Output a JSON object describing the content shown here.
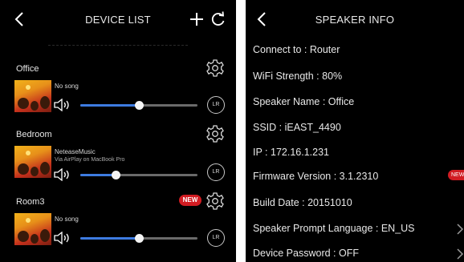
{
  "device_list": {
    "title": "DEVICE LIST",
    "rooms": [
      {
        "name": "Office",
        "song": "No song",
        "subtitle": "",
        "volume": 0.5,
        "lr_label": "LR",
        "new_badge": ""
      },
      {
        "name": "Bedroom",
        "song": "NeteaseMusic",
        "subtitle": "Via AirPlay on MacBook Pro",
        "volume": 0.3,
        "lr_label": "LR",
        "new_badge": ""
      },
      {
        "name": "Room3",
        "song": "No song",
        "subtitle": "",
        "volume": 0.5,
        "lr_label": "LR",
        "new_badge": "NEW"
      }
    ]
  },
  "speaker_info": {
    "title": "SPEAKER INFO",
    "rows": [
      "Connect to : Router",
      "WiFi Strength : 80%",
      "Speaker Name : Office",
      "SSID : iEAST_4490",
      "IP : 172.16.1.231",
      "Firmware Version : 3.1.2310",
      "Build Date : 20151010",
      "Speaker Prompt Language : EN_US",
      "Device Password : OFF"
    ],
    "firmware_badge": "NEW"
  },
  "colors": {
    "accent": "#3d7be0",
    "badge": "#d11c22",
    "background": "#000000"
  }
}
